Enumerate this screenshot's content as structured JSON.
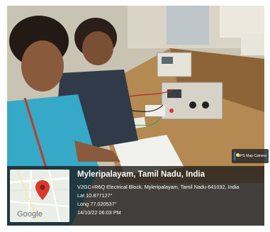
{
  "photo_badge": {
    "label": "GPS Map Camera"
  },
  "map": {
    "brand": "Google",
    "pin_color": "#d93a2b"
  },
  "location": {
    "title": "Myleripalayam, Tamil Nadu, India",
    "address": "V2GC+R6Q Electrical Block, Myleripalayam, Tamil Nadu 641032, India",
    "lat": "Lat 10.877127°",
    "long": "Long 77.020537°",
    "datetime": "14/10/22 06:03 PM"
  }
}
